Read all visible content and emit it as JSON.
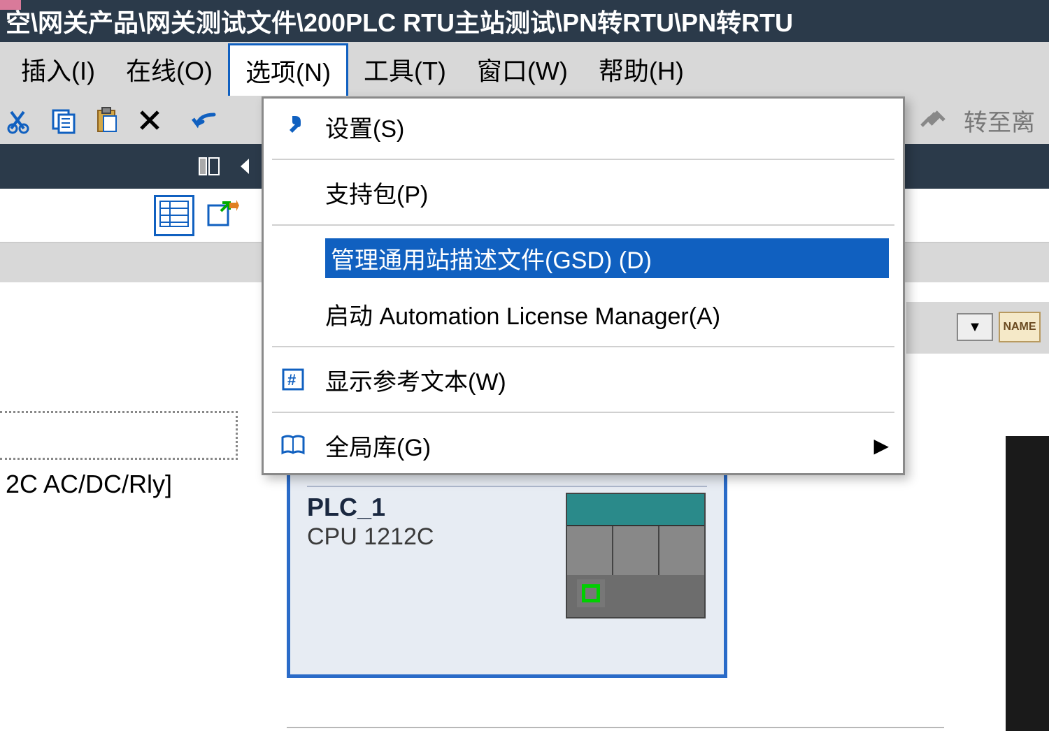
{
  "titlebar": {
    "path": "空\\网关产品\\网关测试文件\\200PLC RTU主站测试\\PN转RTU\\PN转RTU"
  },
  "menubar": {
    "insert": "插入(I)",
    "online": "在线(O)",
    "options": "选项(N)",
    "tools": "工具(T)",
    "window": "窗口(W)",
    "help": "帮助(H)"
  },
  "right_toolbar": {
    "goto": "转至离"
  },
  "dropdown": {
    "settings": "设置(S)",
    "support": "支持包(P)",
    "gsd": "管理通用站描述文件(GSD) (D)",
    "alm": "启动 Automation License Manager(A)",
    "reftext": "显示参考文本(W)",
    "globallib": "全局库(G)"
  },
  "left_panel": {
    "device": "2C AC/DC/Rly]"
  },
  "plc": {
    "name": "PLC_1",
    "cpu": "CPU 1212C"
  },
  "name_label": "NAME"
}
